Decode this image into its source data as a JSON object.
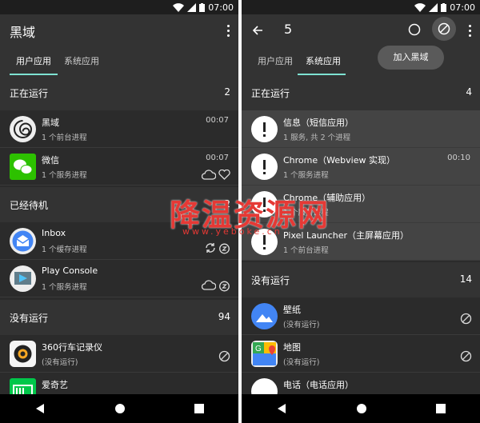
{
  "status": {
    "time": "07:00"
  },
  "left": {
    "title": "黑域",
    "tabs": [
      "用户应用",
      "系统应用"
    ],
    "sections": [
      {
        "label": "正在运行",
        "count": "2"
      },
      {
        "label": "已经待机",
        "count": "2"
      },
      {
        "label": "没有运行",
        "count": "94"
      }
    ],
    "running": [
      {
        "name": "黑域",
        "sub": "1 个前台进程",
        "time": "00:07"
      },
      {
        "name": "微信",
        "sub": "1 个服务进程",
        "time": "00:07"
      }
    ],
    "standby": [
      {
        "name": "Inbox",
        "sub": "1 个缓存进程"
      },
      {
        "name": "Play Console",
        "sub": "1 个服务进程"
      }
    ],
    "stopped": [
      {
        "name": "360行车记录仪",
        "sub": "(没有运行)"
      },
      {
        "name": "爱奇艺",
        "sub": ""
      }
    ]
  },
  "right": {
    "title": "5",
    "tooltip": "加入黑域",
    "tabs": [
      "用户应用",
      "系统应用"
    ],
    "sections": [
      {
        "label": "正在运行",
        "count": "4"
      },
      {
        "label": "没有运行",
        "count": "14"
      }
    ],
    "running": [
      {
        "name": "信息（短信应用）",
        "sub": "1 服务, 共 2 个进程",
        "time": ""
      },
      {
        "name": "Chrome（Webview 实现）",
        "sub": "1 个服务进程",
        "time": "00:10"
      },
      {
        "name": "Chrome（辅助应用）",
        "sub": "1 个服务进程",
        "time": ""
      },
      {
        "name": "Pixel Launcher（主屏幕应用）",
        "sub": "1 个前台进程",
        "time": ""
      }
    ],
    "stopped": [
      {
        "name": "壁纸",
        "sub": "(没有运行)"
      },
      {
        "name": "地图",
        "sub": "(没有运行)"
      },
      {
        "name": "电话（电话应用）",
        "sub": ""
      }
    ]
  },
  "watermark": {
    "title": "降温资源网",
    "url": "www.yeboke.cn"
  },
  "colors": {
    "accent": "#7ee3d2",
    "background": "#2b2b2b",
    "appbar": "#333333"
  }
}
